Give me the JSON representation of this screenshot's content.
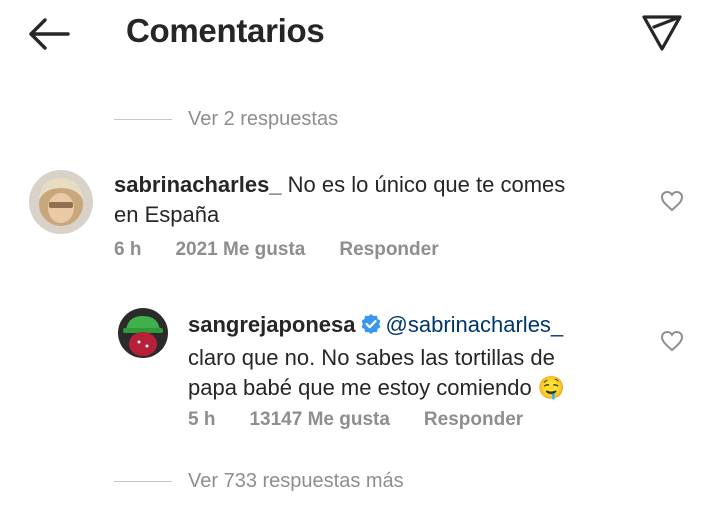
{
  "header": {
    "title": "Comentarios"
  },
  "thread": {
    "view_previous": "Ver 2 respuestas",
    "view_more": "Ver 733 respuestas más"
  },
  "comments": [
    {
      "username": "sabrinacharles_",
      "text_line1": "No es lo único que te comes",
      "text_line2": "en España",
      "time": "6 h",
      "likes": "2021 Me gusta",
      "reply_label": "Responder"
    },
    {
      "username": "sangrejaponesa",
      "mention": "@sabrinacharles_",
      "text_line1": "claro que no. No sabes las tortillas de",
      "text_line2": "papa babé que me estoy comiendo",
      "emoji": "🤤",
      "time": "5 h",
      "likes": "13147 Me gusta",
      "reply_label": "Responder"
    }
  ],
  "icons": {
    "back": "arrow-left-icon",
    "send": "paper-plane-icon",
    "like": "heart-outline-icon",
    "verified": "verified-badge-icon"
  },
  "colors": {
    "text": "#262626",
    "secondary": "#8e8e8e",
    "mention": "#00376b",
    "verified": "#3897f0"
  }
}
